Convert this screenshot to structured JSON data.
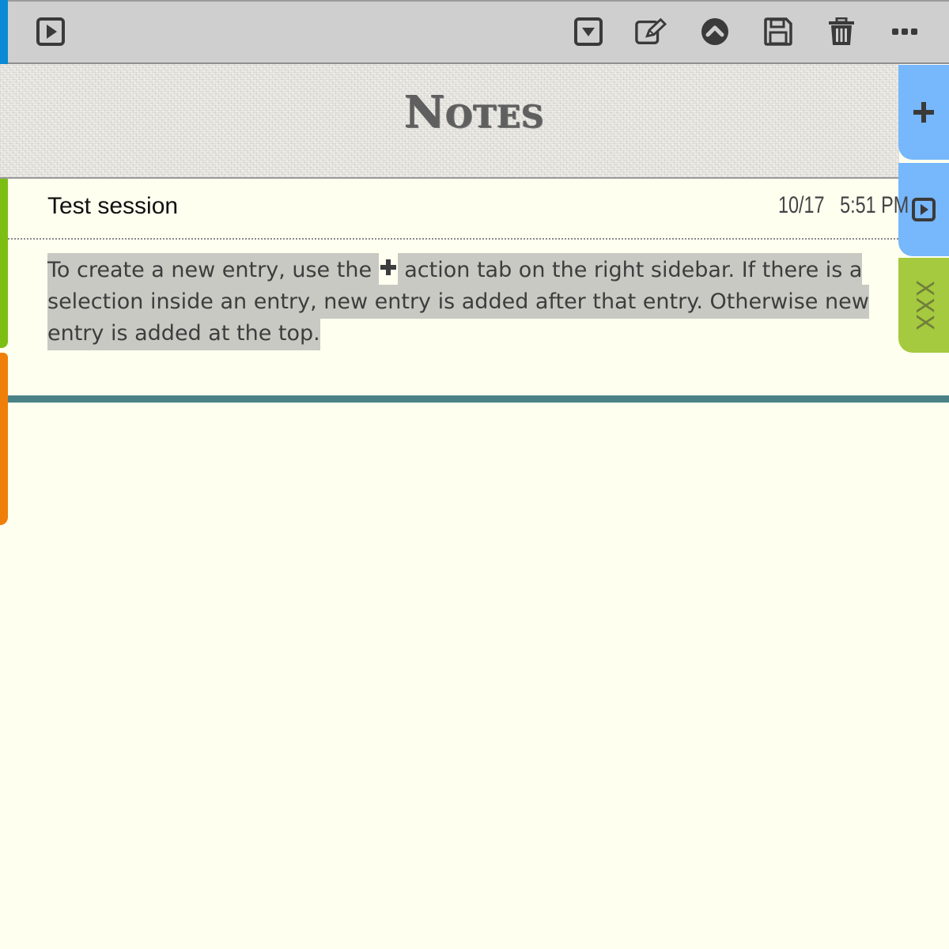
{
  "app": {
    "title": "Notes"
  },
  "toolbar": {
    "left": [
      {
        "icon": "play-icon"
      }
    ],
    "right": [
      {
        "icon": "chevron-down-box-icon"
      },
      {
        "icon": "edit-icon"
      },
      {
        "icon": "chevron-up-circle-icon"
      },
      {
        "icon": "save-icon"
      },
      {
        "icon": "trash-icon"
      },
      {
        "icon": "more-icon"
      }
    ]
  },
  "sidebar_right": {
    "tabs": [
      {
        "icon": "plus-icon"
      },
      {
        "icon": "play-icon"
      },
      {
        "label": "XXX"
      }
    ]
  },
  "entry": {
    "title": "Test session",
    "date": "10/17",
    "time": "5:51 PM",
    "body_part1": "To create a new entry, use the",
    "body_part2": "action tab on the right sidebar. If there is a selection inside an entry, new entry is added after that entry. Otherwise new entry is added at the top."
  },
  "colors": {
    "toolbar_bg": "#cfcfcf",
    "page_bg": "#fffff0",
    "tab_blue": "#77b7fb",
    "tab_green": "#a5c93f",
    "left_blue": "#0a8ad6",
    "left_green": "#7cbf12",
    "left_orange": "#f07f09",
    "rule": "#4a8288",
    "highlight": "#c9c9c3"
  }
}
